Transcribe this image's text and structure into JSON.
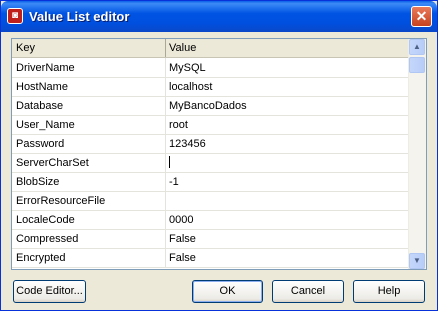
{
  "window": {
    "title": "Value List editor",
    "app_icon": "database-red-icon",
    "close_label": "✕"
  },
  "grid": {
    "headers": {
      "key": "Key",
      "value": "Value"
    },
    "rows": [
      {
        "key": "DriverName",
        "value": "MySQL"
      },
      {
        "key": "HostName",
        "value": "localhost"
      },
      {
        "key": "Database",
        "value": "MyBancoDados"
      },
      {
        "key": "User_Name",
        "value": "root"
      },
      {
        "key": "Password",
        "value": "123456"
      },
      {
        "key": "ServerCharSet",
        "value": ""
      },
      {
        "key": "BlobSize",
        "value": "-1"
      },
      {
        "key": "ErrorResourceFile",
        "value": ""
      },
      {
        "key": "LocaleCode",
        "value": "0000"
      },
      {
        "key": "Compressed",
        "value": "False"
      },
      {
        "key": "Encrypted",
        "value": "False"
      }
    ]
  },
  "buttons": {
    "code_editor": "Code Editor...",
    "ok": "OK",
    "cancel": "Cancel",
    "help": "Help"
  }
}
